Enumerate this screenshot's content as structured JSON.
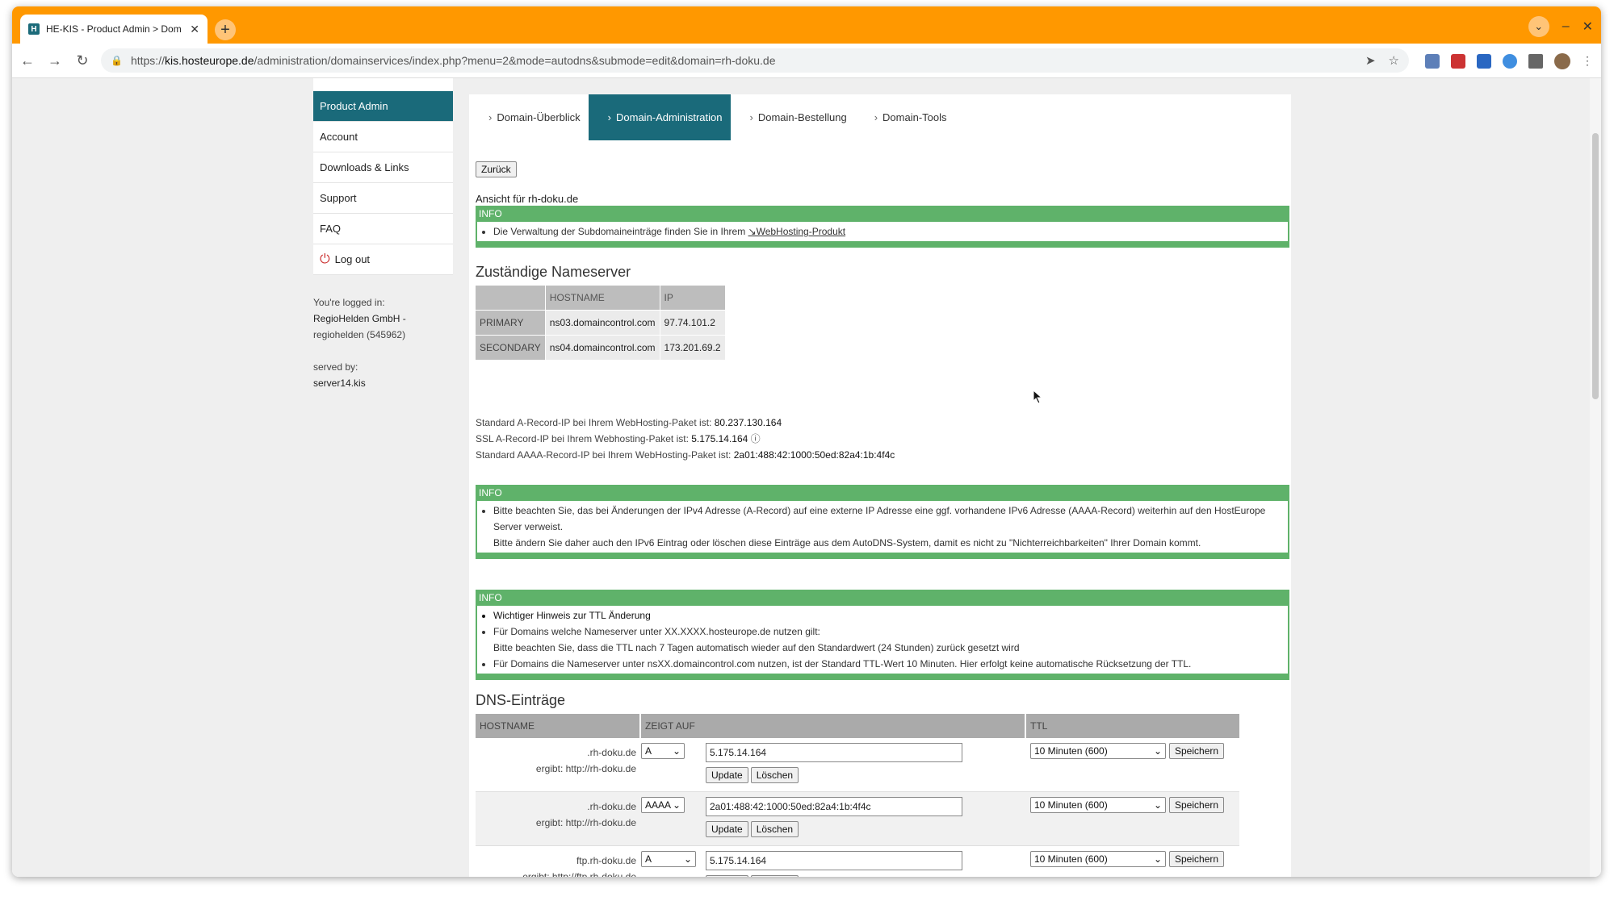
{
  "browser": {
    "tab_title": "HE-KIS - Product Admin > Dom",
    "tab_favicon": "H",
    "url_prefix": "https://",
    "url_host": "kis.hosteurope.de",
    "url_path": "/administration/domainservices/index.php?menu=2&mode=autodns&submode=edit&domain=rh-doku.de"
  },
  "sidebar": {
    "items": [
      {
        "label": "Product Admin"
      },
      {
        "label": "Account"
      },
      {
        "label": "Downloads & Links"
      },
      {
        "label": "Support"
      },
      {
        "label": "FAQ"
      },
      {
        "label": "Log out"
      }
    ],
    "logged_in_label": "You're logged in:",
    "company": "RegioHelden GmbH -",
    "account": "regiohelden (545962)",
    "served_by_label": "served by:",
    "server": "server14.kis"
  },
  "main": {
    "tabs": [
      {
        "label": "Domain-Überblick"
      },
      {
        "label": "Domain-Administration"
      },
      {
        "label": "Domain-Bestellung"
      },
      {
        "label": "Domain-Tools"
      }
    ],
    "back_button": "Zurück",
    "view_for": "Ansicht für rh-doku.de",
    "info1": {
      "head": "INFO",
      "text": "Die Verwaltung der Subdomaineinträge finden Sie in Ihrem ",
      "link": "↘WebHosting-Produkt"
    },
    "nameserver_title": "Zuständige Nameserver",
    "ns_table": {
      "headers": [
        "HOSTNAME",
        "IP"
      ],
      "rows": [
        {
          "label": "PRIMARY",
          "hostname": "ns03.domaincontrol.com",
          "ip": "97.74.101.2"
        },
        {
          "label": "SECONDARY",
          "hostname": "ns04.domaincontrol.com",
          "ip": "173.201.69.2"
        }
      ]
    },
    "records": [
      {
        "text": "Standard A-Record-IP bei Ihrem WebHosting-Paket ist: ",
        "value": "80.237.130.164"
      },
      {
        "text": "SSL A-Record-IP bei Ihrem Webhosting-Paket ist: ",
        "value": "5.175.14.164"
      },
      {
        "text": "Standard AAAA-Record-IP bei Ihrem WebHosting-Paket ist: ",
        "value": "2a01:488:42:1000:50ed:82a4:1b:4f4c"
      }
    ],
    "info2": {
      "head": "INFO",
      "line1": "Bitte beachten Sie, das bei Änderungen der IPv4 Adresse (A-Record) auf eine externe IP Adresse eine ggf. vorhandene IPv6 Adresse (AAAA-Record) weiterhin auf den HostEurope Server verweist.",
      "line2": "Bitte ändern Sie daher auch den IPv6 Eintrag oder löschen diese Einträge aus dem AutoDNS-System, damit es nicht zu \"Nichterreichbarkeiten\" Ihrer Domain kommt."
    },
    "info3": {
      "head": "INFO",
      "items": [
        "Wichtiger Hinweis zur TTL Änderung",
        "Für Domains welche Nameserver unter XX.XXXX.hosteurope.de nutzen gilt:",
        "Bitte beachten Sie, dass die TTL nach 7 Tagen automatisch wieder auf den Standardwert (24 Stunden) zurück gesetzt wird",
        "Für Domains die Nameserver unter nsXX.domaincontrol.com nutzen, ist der Standard TTL-Wert 10 Minuten. Hier erfolgt keine automatische Rücksetzung der TTL."
      ]
    },
    "dns_title": "DNS-Einträge",
    "dns_table": {
      "headers": [
        "HOSTNAME",
        "ZEIGT AUF",
        "TTL"
      ],
      "update_label": "Update",
      "delete_label": "Löschen",
      "save_label": "Speichern",
      "rows": [
        {
          "host": ".rh-doku.de",
          "result": "ergibt: http://rh-doku.de",
          "type": "A",
          "value": "5.175.14.164",
          "ttl": "10 Minuten (600)"
        },
        {
          "host": ".rh-doku.de",
          "result": "ergibt: http://rh-doku.de",
          "type": "AAAA",
          "value": "2a01:488:42:1000:50ed:82a4:1b:4f4c",
          "ttl": "10 Minuten (600)"
        },
        {
          "host": "ftp.rh-doku.de",
          "result": "ergibt: http://ftp.rh-doku.de",
          "type": "A",
          "value": "5.175.14.164",
          "ttl": "10 Minuten (600)"
        }
      ]
    }
  }
}
